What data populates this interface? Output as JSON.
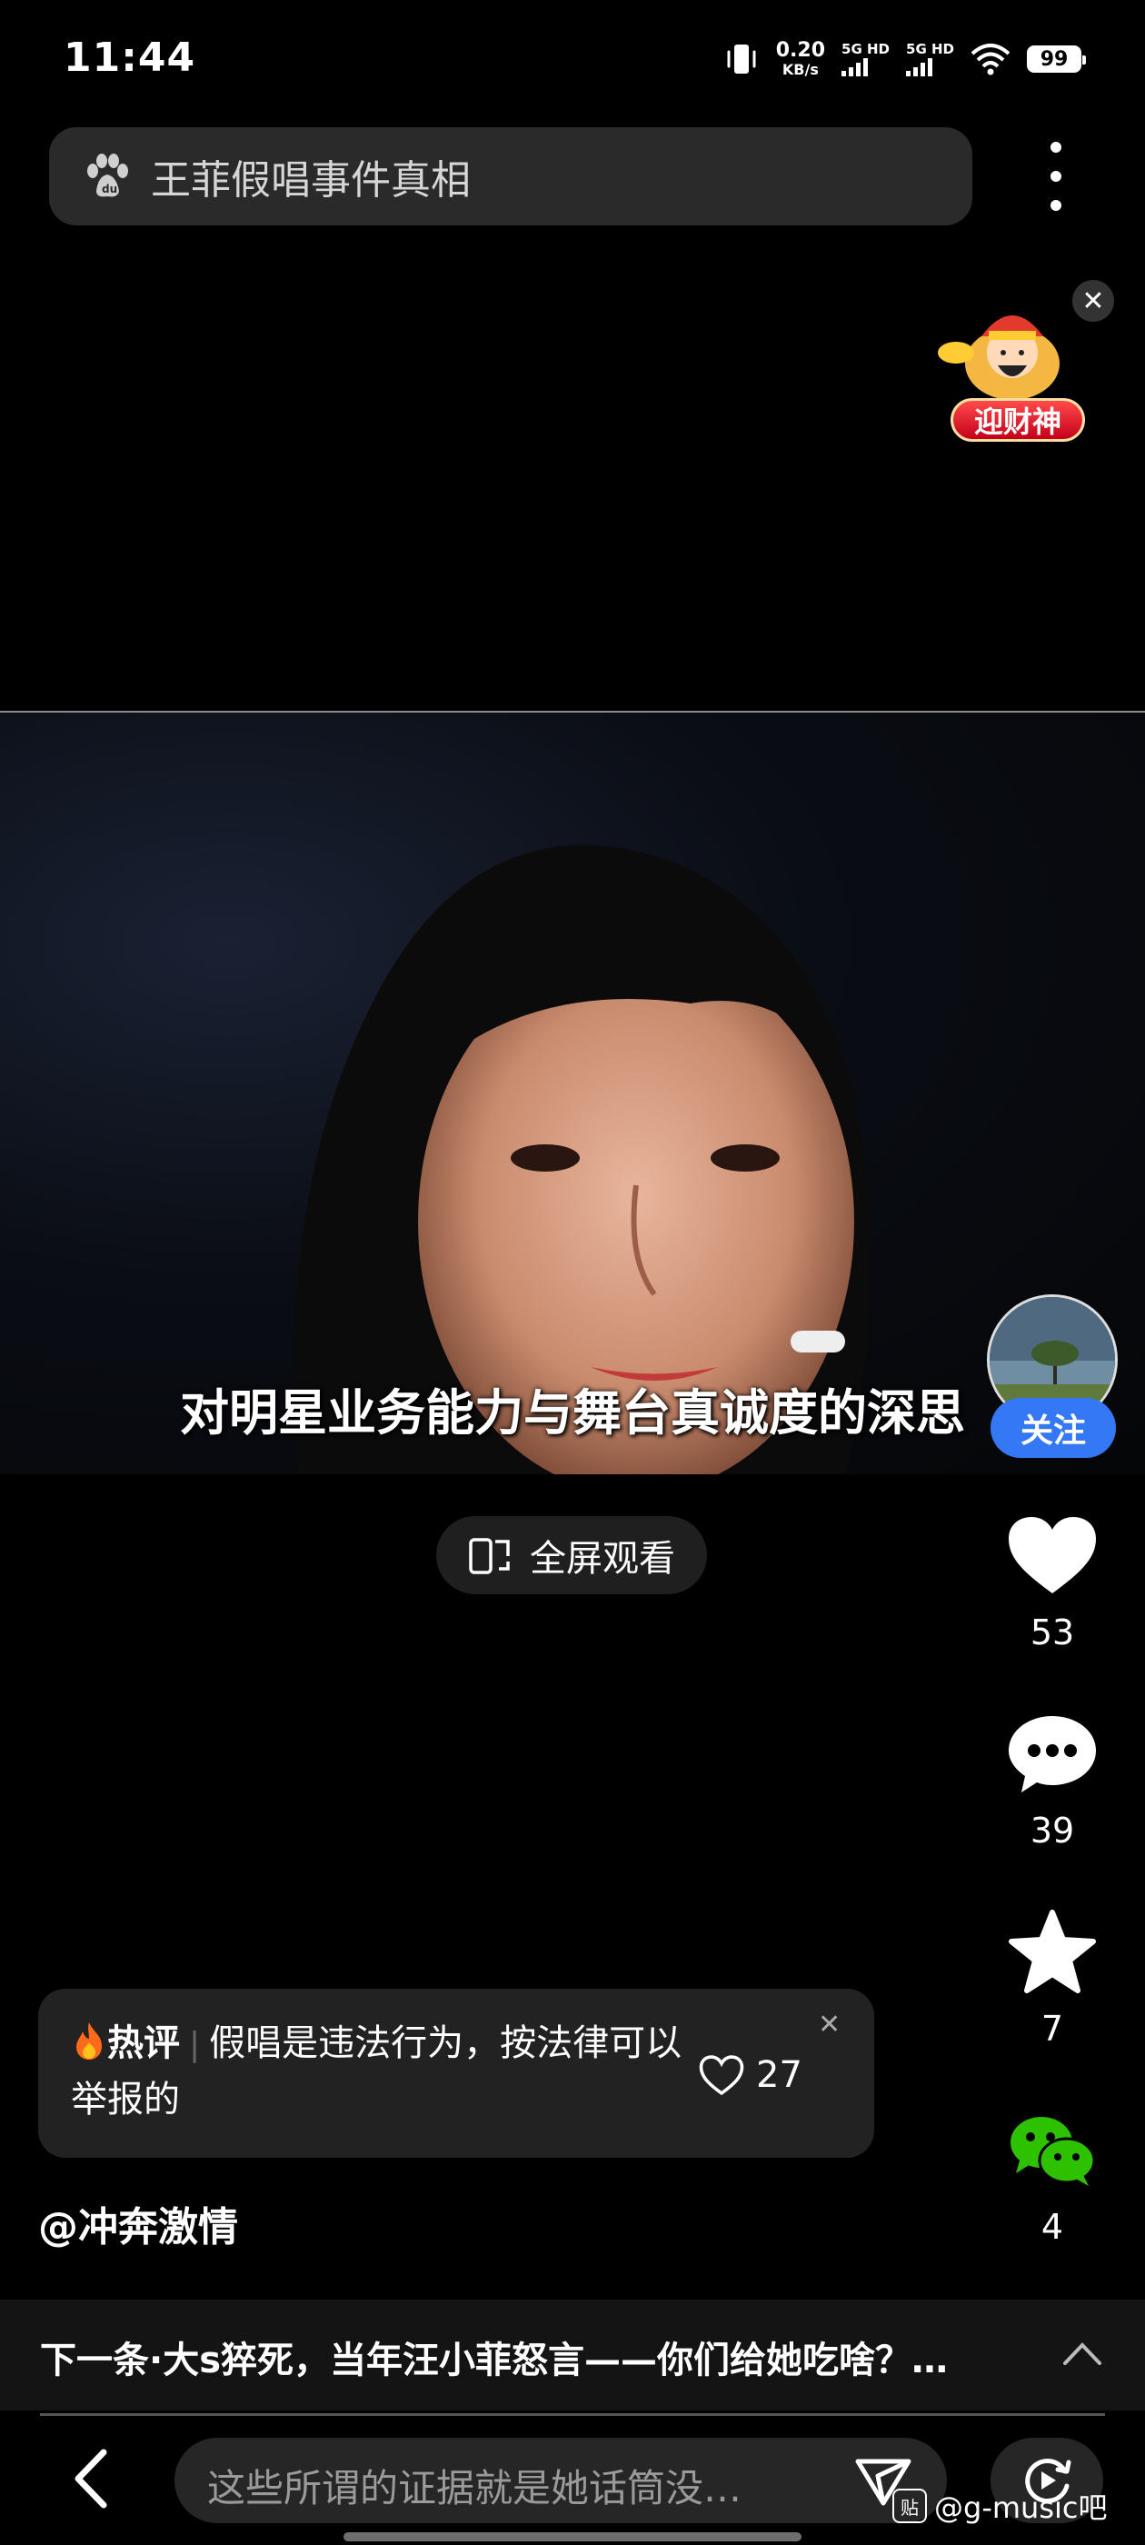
{
  "status_bar": {
    "time": "11:44",
    "net_speed": "0.20",
    "net_unit": "KB/s",
    "sim1_label": "5G HD",
    "sim2_label": "5G HD",
    "battery": "99"
  },
  "search": {
    "query": "王菲假唱事件真相",
    "icon": "baidu-paw-icon"
  },
  "promo": {
    "label": "迎财神",
    "close": "✕"
  },
  "video": {
    "subtitle": "对明星业务能力与舞台真诚度的深思"
  },
  "fullscreen": {
    "label": "全屏观看"
  },
  "rail": {
    "follow_label": "关注",
    "like_count": "53",
    "comment_count": "39",
    "favorite_count": "7",
    "share_count": "4"
  },
  "hot_comment": {
    "tag": "热评",
    "text": "假唱是违法行为，按法律可以举报的",
    "like_count": "27",
    "close": "✕"
  },
  "author": {
    "handle": "@冲奔激情"
  },
  "next": {
    "text": "下一条·大s猝死，当年汪小菲怒言——你们给她吃啥？…"
  },
  "input": {
    "placeholder": "这些所谓的证据就是她话筒没…"
  },
  "watermark": {
    "badge": "贴",
    "text": "@g-music吧"
  }
}
